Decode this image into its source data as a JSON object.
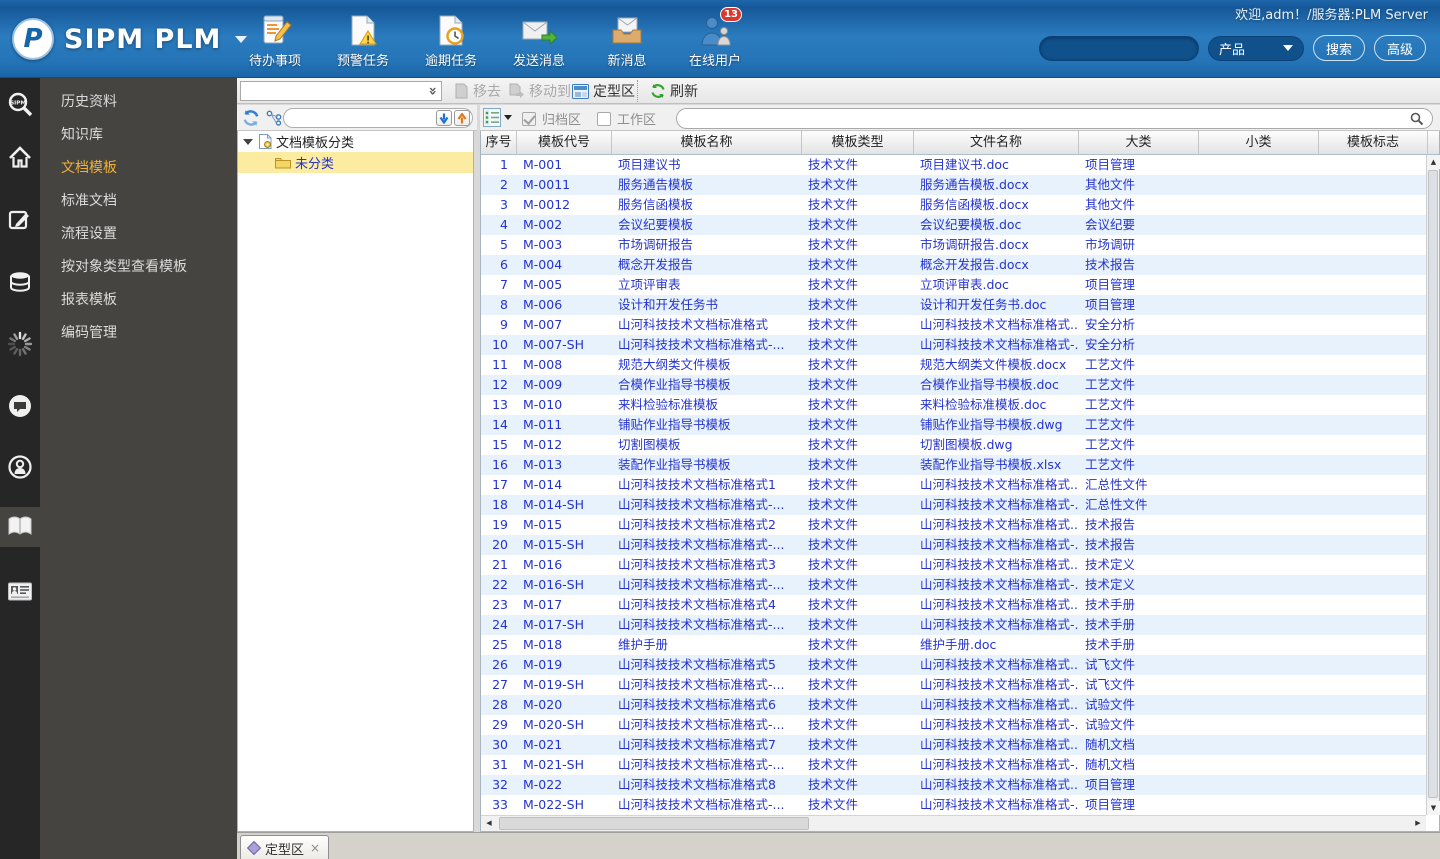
{
  "header": {
    "welcome": "欢迎,adm！/服务器:PLM Server",
    "logo_badge": "P",
    "logo_text": "SIPM PLM",
    "toolbar": [
      {
        "label": "待办事项",
        "icon": "todo-icon"
      },
      {
        "label": "预警任务",
        "icon": "warning-task-icon"
      },
      {
        "label": "逾期任务",
        "icon": "overdue-task-icon"
      },
      {
        "label": "发送消息",
        "icon": "send-message-icon"
      },
      {
        "label": "新消息",
        "icon": "new-message-icon"
      },
      {
        "label": "在线用户",
        "icon": "online-users-icon",
        "badge": "13"
      }
    ],
    "search": {
      "value": "",
      "category": "产品",
      "search_label": "搜索",
      "advanced_label": "高级"
    }
  },
  "rail": {
    "icons": [
      {
        "name": "sipm-search-icon",
        "active": false
      },
      {
        "name": "home-icon",
        "active": false
      },
      {
        "name": "edit-icon",
        "active": false
      },
      {
        "name": "database-icon",
        "active": false
      },
      {
        "name": "loading-icon",
        "active": false
      },
      {
        "name": "chat-icon",
        "active": false
      },
      {
        "name": "user-circle-icon",
        "active": false
      },
      {
        "name": "book-icon",
        "active": true
      },
      {
        "name": "id-card-icon",
        "active": false
      }
    ]
  },
  "sidebar_menu": {
    "items": [
      {
        "label": "历史资料",
        "active": false
      },
      {
        "label": "知识库",
        "active": false
      },
      {
        "label": "文档模板",
        "active": true
      },
      {
        "label": "标准文档",
        "active": false
      },
      {
        "label": "流程设置",
        "active": false
      },
      {
        "label": "按对象类型查看模板",
        "active": false
      },
      {
        "label": "报表模板",
        "active": false
      },
      {
        "label": "编码管理",
        "active": false
      }
    ]
  },
  "toolbar1": {
    "remove_label": "移去",
    "move_to_label": "移动到",
    "pattern_zone_label": "定型区",
    "refresh_label": "刷新"
  },
  "filters": {
    "archive_label": "归档区",
    "archive_checked": true,
    "work_label": "工作区",
    "work_checked": false,
    "tree_search_value": "",
    "grid_search_value": ""
  },
  "tree": {
    "root_label": "文档模板分类",
    "child_label": "未分类"
  },
  "table": {
    "columns": [
      "序号",
      "模板代号",
      "模板名称",
      "模板类型",
      "文件名称",
      "大类",
      "小类",
      "模板标志"
    ],
    "rows": [
      [
        "1",
        "M-001",
        "项目建议书",
        "技术文件",
        "项目建议书.doc",
        "项目管理",
        "",
        ""
      ],
      [
        "2",
        "M-0011",
        "服务通告模板",
        "技术文件",
        "服务通告模板.docx",
        "其他文件",
        "",
        ""
      ],
      [
        "3",
        "M-0012",
        "服务信函模板",
        "技术文件",
        "服务信函模板.docx",
        "其他文件",
        "",
        ""
      ],
      [
        "4",
        "M-002",
        "会议纪要模板",
        "技术文件",
        "会议纪要模板.doc",
        "会议纪要",
        "",
        ""
      ],
      [
        "5",
        "M-003",
        "市场调研报告",
        "技术文件",
        "市场调研报告.docx",
        "市场调研",
        "",
        ""
      ],
      [
        "6",
        "M-004",
        "概念开发报告",
        "技术文件",
        "概念开发报告.docx",
        "技术报告",
        "",
        ""
      ],
      [
        "7",
        "M-005",
        "立项评审表",
        "技术文件",
        "立项评审表.doc",
        "项目管理",
        "",
        ""
      ],
      [
        "8",
        "M-006",
        "设计和开发任务书",
        "技术文件",
        "设计和开发任务书.doc",
        "项目管理",
        "",
        ""
      ],
      [
        "9",
        "M-007",
        "山河科技技术文档标准格式",
        "技术文件",
        "山河科技技术文档标准格式...",
        "安全分析",
        "",
        ""
      ],
      [
        "10",
        "M-007-SH",
        "山河科技技术文档标准格式-...",
        "技术文件",
        "山河科技技术文档标准格式-...",
        "安全分析",
        "",
        ""
      ],
      [
        "11",
        "M-008",
        "规范大纲类文件模板",
        "技术文件",
        "规范大纲类文件模板.docx",
        "工艺文件",
        "",
        ""
      ],
      [
        "12",
        "M-009",
        "合模作业指导书模板",
        "技术文件",
        "合模作业指导书模板.doc",
        "工艺文件",
        "",
        ""
      ],
      [
        "13",
        "M-010",
        "来料检验标准模板",
        "技术文件",
        "来料检验标准模板.doc",
        "工艺文件",
        "",
        ""
      ],
      [
        "14",
        "M-011",
        "铺贴作业指导书模板",
        "技术文件",
        "铺贴作业指导书模板.dwg",
        "工艺文件",
        "",
        ""
      ],
      [
        "15",
        "M-012",
        "切割图模板",
        "技术文件",
        "切割图模板.dwg",
        "工艺文件",
        "",
        ""
      ],
      [
        "16",
        "M-013",
        "装配作业指导书模板",
        "技术文件",
        "装配作业指导书模板.xlsx",
        "工艺文件",
        "",
        ""
      ],
      [
        "17",
        "M-014",
        "山河科技技术文档标准格式1",
        "技术文件",
        "山河科技技术文档标准格式...",
        "汇总性文件",
        "",
        ""
      ],
      [
        "18",
        "M-014-SH",
        "山河科技技术文档标准格式-...",
        "技术文件",
        "山河科技技术文档标准格式-...",
        "汇总性文件",
        "",
        ""
      ],
      [
        "19",
        "M-015",
        "山河科技技术文档标准格式2",
        "技术文件",
        "山河科技技术文档标准格式...",
        "技术报告",
        "",
        ""
      ],
      [
        "20",
        "M-015-SH",
        "山河科技技术文档标准格式-...",
        "技术文件",
        "山河科技技术文档标准格式-...",
        "技术报告",
        "",
        ""
      ],
      [
        "21",
        "M-016",
        "山河科技技术文档标准格式3",
        "技术文件",
        "山河科技技术文档标准格式...",
        "技术定义",
        "",
        ""
      ],
      [
        "22",
        "M-016-SH",
        "山河科技技术文档标准格式-...",
        "技术文件",
        "山河科技技术文档标准格式-...",
        "技术定义",
        "",
        ""
      ],
      [
        "23",
        "M-017",
        "山河科技技术文档标准格式4",
        "技术文件",
        "山河科技技术文档标准格式...",
        "技术手册",
        "",
        ""
      ],
      [
        "24",
        "M-017-SH",
        "山河科技技术文档标准格式-...",
        "技术文件",
        "山河科技技术文档标准格式-...",
        "技术手册",
        "",
        ""
      ],
      [
        "25",
        "M-018",
        "维护手册",
        "技术文件",
        "维护手册.doc",
        "技术手册",
        "",
        ""
      ],
      [
        "26",
        "M-019",
        "山河科技技术文档标准格式5",
        "技术文件",
        "山河科技技术文档标准格式...",
        "试飞文件",
        "",
        ""
      ],
      [
        "27",
        "M-019-SH",
        "山河科技技术文档标准格式-...",
        "技术文件",
        "山河科技技术文档标准格式-...",
        "试飞文件",
        "",
        ""
      ],
      [
        "28",
        "M-020",
        "山河科技技术文档标准格式6",
        "技术文件",
        "山河科技技术文档标准格式...",
        "试验文件",
        "",
        ""
      ],
      [
        "29",
        "M-020-SH",
        "山河科技技术文档标准格式-...",
        "技术文件",
        "山河科技技术文档标准格式-...",
        "试验文件",
        "",
        ""
      ],
      [
        "30",
        "M-021",
        "山河科技技术文档标准格式7",
        "技术文件",
        "山河科技技术文档标准格式...",
        "随机文档",
        "",
        ""
      ],
      [
        "31",
        "M-021-SH",
        "山河科技技术文档标准格式-...",
        "技术文件",
        "山河科技技术文档标准格式-...",
        "随机文档",
        "",
        ""
      ],
      [
        "32",
        "M-022",
        "山河科技技术文档标准格式8",
        "技术文件",
        "山河科技技术文档标准格式...",
        "项目管理",
        "",
        ""
      ],
      [
        "33",
        "M-022-SH",
        "山河科技技术文档标准格式-...",
        "技术文件",
        "山河科技技术文档标准格式-...",
        "项目管理",
        "",
        ""
      ]
    ]
  },
  "bottom_tab": {
    "label": "定型区"
  },
  "colors": {
    "header_blue": "#2474b7",
    "menu_active": "#f2b135",
    "link_blue": "#2433d0",
    "row_alt": "#e8f2fc",
    "tree_selected": "#fbeca2",
    "badge_red": "#d43a2f"
  }
}
